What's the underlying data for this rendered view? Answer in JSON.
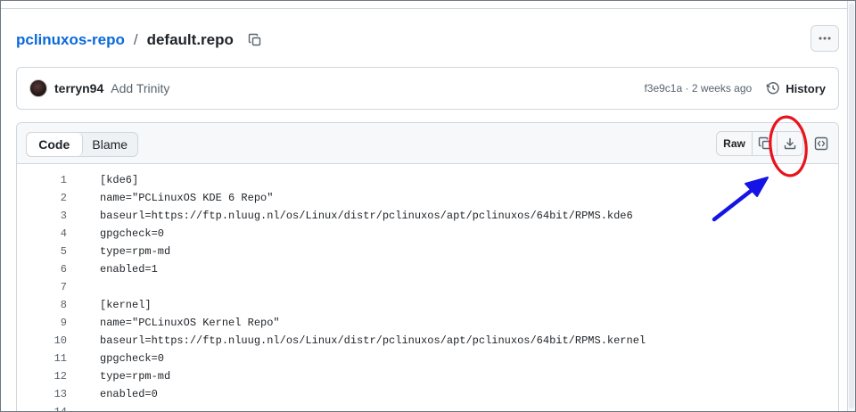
{
  "breadcrumb": {
    "repo": "pclinuxos-repo",
    "separator": "/",
    "file": "default.repo"
  },
  "commit": {
    "author": "terryn94",
    "message": "Add Trinity",
    "meta": "f3e9c1a · 2 weeks ago",
    "history_label": "History"
  },
  "file_header": {
    "tabs": [
      {
        "label": "Code",
        "active": true
      },
      {
        "label": "Blame",
        "active": false
      }
    ],
    "raw_label": "Raw"
  },
  "code_lines": [
    {
      "n": "1",
      "text": "[kde6]"
    },
    {
      "n": "2",
      "text": "name=\"PCLinuxOS KDE 6 Repo\""
    },
    {
      "n": "3",
      "text": "baseurl=https://ftp.nluug.nl/os/Linux/distr/pclinuxos/apt/pclinuxos/64bit/RPMS.kde6"
    },
    {
      "n": "4",
      "text": "gpgcheck=0"
    },
    {
      "n": "5",
      "text": "type=rpm-md"
    },
    {
      "n": "6",
      "text": "enabled=1"
    },
    {
      "n": "7",
      "text": ""
    },
    {
      "n": "8",
      "text": "[kernel]"
    },
    {
      "n": "9",
      "text": "name=\"PCLinuxOS Kernel Repo\""
    },
    {
      "n": "10",
      "text": "baseurl=https://ftp.nluug.nl/os/Linux/distr/pclinuxos/apt/pclinuxos/64bit/RPMS.kernel"
    },
    {
      "n": "11",
      "text": "gpgcheck=0"
    },
    {
      "n": "12",
      "text": "type=rpm-md"
    },
    {
      "n": "13",
      "text": "enabled=0"
    },
    {
      "n": "14",
      "text": ""
    }
  ],
  "icons": {
    "copy_path": "copy-icon",
    "more": "kebab-horizontal-icon",
    "history": "history-icon",
    "copy_raw": "copy-icon",
    "download": "download-icon",
    "symbols": "code-square-icon"
  },
  "colors": {
    "link": "#0969da",
    "annotation_circle": "#e8141c",
    "annotation_arrow": "#1414e6"
  }
}
